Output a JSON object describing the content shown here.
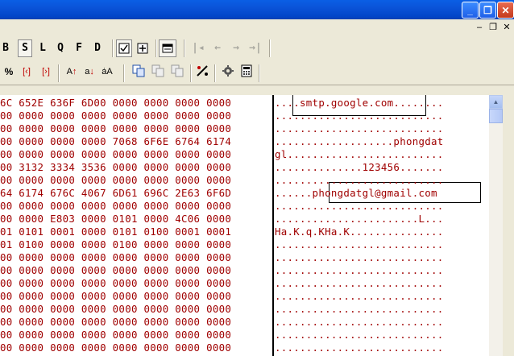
{
  "window": {
    "caption_buttons": [
      "_",
      "❐",
      "✕"
    ],
    "mdi_buttons": [
      "–",
      "❐",
      "✕"
    ]
  },
  "toolbar1": {
    "view_buttons": [
      "B",
      "S",
      "L",
      "Q",
      "F",
      "D"
    ],
    "icons": [
      "checklist-icon",
      "add-icon",
      "window-icon",
      "first-icon",
      "prev-icon",
      "next-icon",
      "last-icon"
    ]
  },
  "toolbar2": {
    "icons": [
      "percent-icon",
      "bracket-left-icon",
      "bracket-right-icon",
      "sort-up-icon",
      "sort-down-icon",
      "replace-text-icon",
      "copy-icon",
      "paste-icon",
      "paste-alt-icon",
      "tools-icon",
      "settings-icon",
      "calculator-icon"
    ]
  },
  "hex_rows": [
    "6C 652E 636F 6D00 0000 0000 0000 0000",
    "00 0000 0000 0000 0000 0000 0000 0000",
    "00 0000 0000 0000 0000 0000 0000 0000",
    "00 0000 0000 0000 7068 6F6E 6764 6174",
    "00 0000 0000 0000 0000 0000 0000 0000",
    "00 3132 3334 3536 0000 0000 0000 0000",
    "00 0000 0000 0000 0000 0000 0000 0000",
    "64 6174 676C 4067 6D61 696C 2E63 6F6D",
    "00 0000 0000 0000 0000 0000 0000 0000",
    "00 0000 E803 0000 0101 0000 4C06 0000",
    "01 0101 0001 0000 0101 0100 0001 0001",
    "01 0100 0000 0000 0100 0000 0000 0000",
    "00 0000 0000 0000 0000 0000 0000 0000",
    "00 0000 0000 0000 0000 0000 0000 0000",
    "00 0000 0000 0000 0000 0000 0000 0000",
    "00 0000 0000 0000 0000 0000 0000 0000",
    "00 0000 0000 0000 0000 0000 0000 0000",
    "00 0000 0000 0000 0000 0000 0000 0000",
    "00 0000 0000 0000 0000 0000 0000 0000",
    "00 0000 0000 0000 0000 0000 0000 0000"
  ],
  "text_rows": [
    "....smtp.google.com........",
    "...........................",
    "...........................",
    "...................phongdat",
    "gl.........................",
    "..............123456.......",
    "...........................",
    "......phongdatgl@gmail.com",
    "...........................",
    ".......................L...",
    "Ha.K.q.KHa.K...............",
    "...........................",
    "...........................",
    "...........................",
    "...........................",
    "...........................",
    "...........................",
    "...........................",
    "...........................",
    "..........................."
  ],
  "colors": {
    "hex_text": "#a00000",
    "titlebar": "#0a53d8",
    "toolbar_bg": "#ece9d8"
  }
}
